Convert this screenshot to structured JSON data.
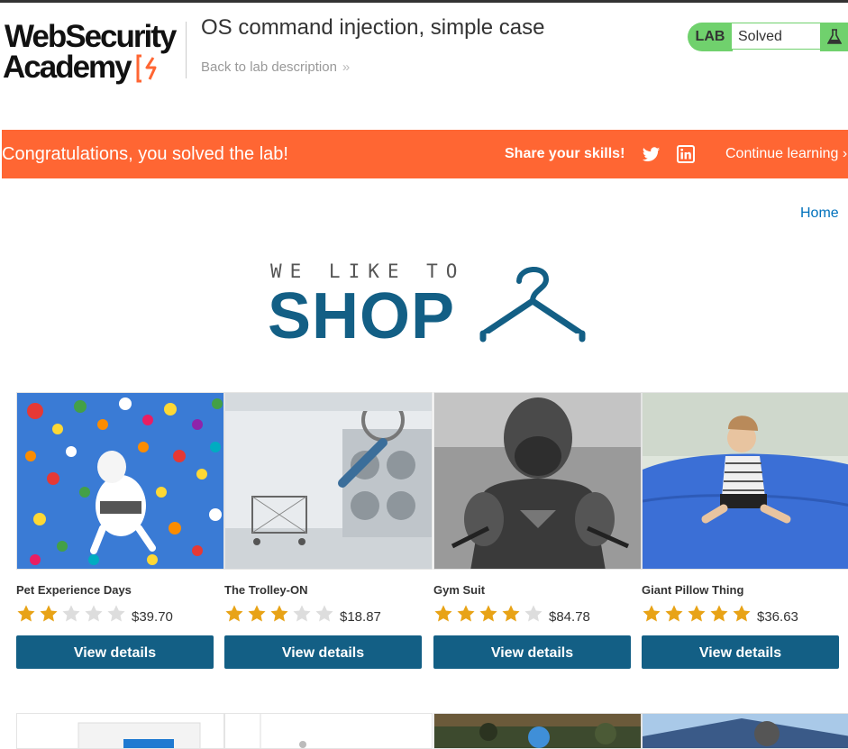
{
  "header": {
    "logo_line1": "WebSecurity",
    "logo_line2": "Academy",
    "lab_title": "OS command injection, simple case",
    "back_link": "Back to lab description",
    "status_label": "LAB",
    "status_value": "Solved"
  },
  "banner": {
    "message": "Congratulations, you solved the lab!",
    "share": "Share your skills!",
    "continue": "Continue learning"
  },
  "shop": {
    "home_link": "Home",
    "logo_small": "WE LIKE TO",
    "logo_big": "SHOP"
  },
  "products": [
    {
      "name": "Pet Experience Days",
      "rating": 2,
      "max_rating": 5,
      "price": "$39.70",
      "button": "View details"
    },
    {
      "name": "The Trolley-ON",
      "rating": 3,
      "max_rating": 5,
      "price": "$18.87",
      "button": "View details"
    },
    {
      "name": "Gym Suit",
      "rating": 4,
      "max_rating": 5,
      "price": "$84.78",
      "button": "View details"
    },
    {
      "name": "Giant Pillow Thing",
      "rating": 5,
      "max_rating": 5,
      "price": "$36.63",
      "button": "View details"
    }
  ],
  "colors": {
    "banner": "#ff6633",
    "status_green": "#70d16d",
    "brand_blue": "#135f85",
    "link_blue": "#0071bc",
    "star_filled": "#e8a317",
    "star_empty": "#dddddd"
  },
  "icons": {
    "share_twitter": "twitter-icon",
    "share_linkedin": "linkedin-icon",
    "status": "flask-icon",
    "back": "chevron-double-right-icon",
    "continue": "chevron-right-icon"
  }
}
